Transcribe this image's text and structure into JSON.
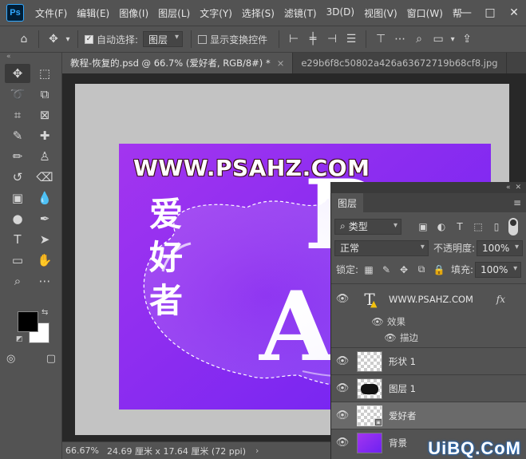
{
  "app": {
    "logo": "Ps"
  },
  "menu": [
    "文件(F)",
    "编辑(E)",
    "图像(I)",
    "图层(L)",
    "文字(Y)",
    "选择(S)",
    "滤镜(T)",
    "3D(D)",
    "视图(V)",
    "窗口(W)",
    "帮"
  ],
  "window_controls": {
    "minimize": "—",
    "maximize": "□",
    "close": "✕"
  },
  "options": {
    "auto_select_label": "自动选择:",
    "auto_select_value": "图层",
    "show_transform_label": "显示变换控件"
  },
  "tabs": [
    {
      "label": "教程-恢复的.psd @ 66.7% (爱好者, RGB/8#) *",
      "close": "×"
    },
    {
      "label": "e29b6f8c50802a426a63672719b68cf8.jpg",
      "close": ""
    }
  ],
  "artwork": {
    "title": "WWW.PSAHZ.COM",
    "vertical_chars": [
      "爱",
      "好",
      "者"
    ],
    "big_letter_1": "P",
    "big_letter_2": "AF",
    "bg_start": "#a335ef",
    "bg_end": "#6d22f2"
  },
  "status": {
    "zoom": "66.67%",
    "size": "24.69 厘米 x 17.64 厘米 (72 ppi)",
    "arrow": "›"
  },
  "colors": {
    "foreground": "#000000",
    "background": "#ffffff"
  },
  "layers_panel": {
    "tab": "图层",
    "filter_kind": "类型",
    "blend_mode": "正常",
    "opacity_label": "不透明度:",
    "opacity_value": "100%",
    "lock_label": "锁定:",
    "fill_label": "填充:",
    "fill_value": "100%",
    "layers": [
      {
        "name": "WWW.PSAHZ.COM",
        "type": "text",
        "fx": "fx",
        "effects_label": "效果",
        "effect": "描边"
      },
      {
        "name": "形状 1",
        "type": "shape"
      },
      {
        "name": "图层 1",
        "type": "pixel"
      },
      {
        "name": "爱好者",
        "type": "smart",
        "selected": true
      },
      {
        "name": "背景",
        "type": "background"
      }
    ]
  },
  "watermark": "UiBQ.CoM"
}
